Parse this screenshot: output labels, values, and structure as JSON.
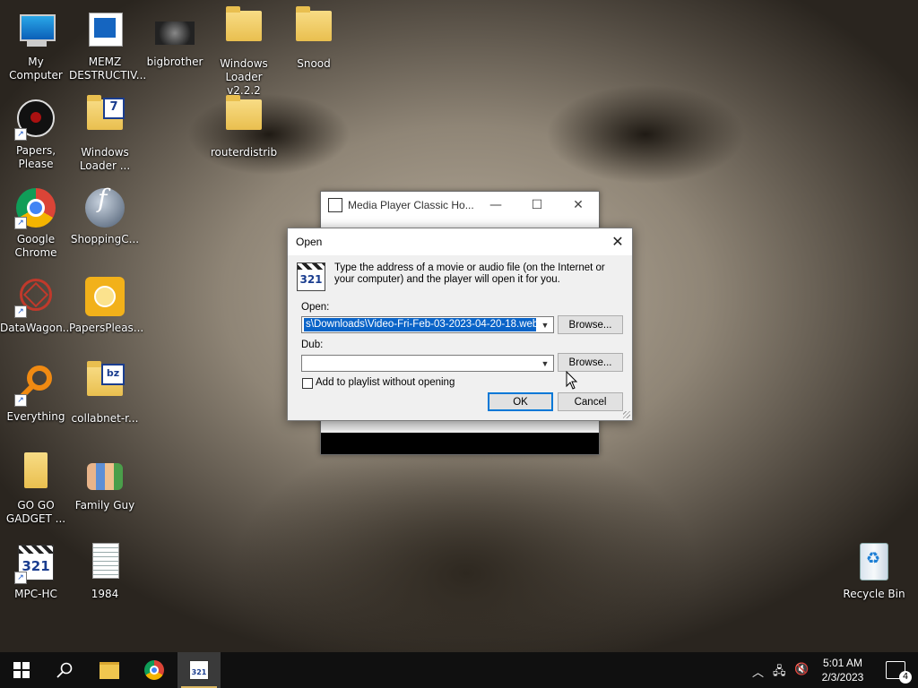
{
  "desktop": {
    "icons": [
      {
        "label": "My Computer"
      },
      {
        "label": "MEMZ DESTRUCTIV..."
      },
      {
        "label": "bigbrother"
      },
      {
        "label": "Windows Loader v2.2.2"
      },
      {
        "label": "Snood"
      },
      {
        "label": "Papers, Please"
      },
      {
        "label": "Windows Loader ..."
      },
      {
        "label": "routerdistrib"
      },
      {
        "label": "Google Chrome"
      },
      {
        "label": "ShoppingC..."
      },
      {
        "label": "DataWagon..."
      },
      {
        "label": "PapersPleas..."
      },
      {
        "label": "Everything"
      },
      {
        "label": "collabnet-r..."
      },
      {
        "label": "GO GO GADGET ..."
      },
      {
        "label": "Family Guy"
      },
      {
        "label": "MPC-HC"
      },
      {
        "label": "1984"
      },
      {
        "label": "Recycle Bin"
      }
    ]
  },
  "mpc_window": {
    "title": "Media Player Classic Ho...",
    "minimize": "—",
    "maximize": "☐",
    "close": "✕"
  },
  "open_dialog": {
    "title": "Open",
    "close": "✕",
    "logo_text": "321",
    "message": "Type the address of a movie or audio file (on the Internet or your computer) and the player will open it for you.",
    "open_label": "Open:",
    "open_value": "s\\Downloads\\Video-Fri-Feb-03-2023-04-20-18.webm",
    "dub_label": "Dub:",
    "dub_value": "",
    "browse_label": "Browse...",
    "add_playlist_label": "Add to playlist without opening",
    "ok_label": "OK",
    "cancel_label": "Cancel"
  },
  "taskbar": {
    "time": "5:01 AM",
    "date": "2/3/2023",
    "notification_count": "4",
    "mpc_icon_text": "321"
  }
}
